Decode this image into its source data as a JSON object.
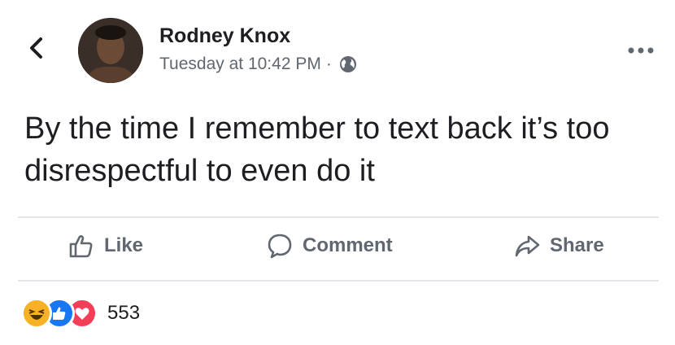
{
  "post": {
    "author": "Rodney Knox",
    "timestamp": "Tuesday at 10:42 PM",
    "separator": "·",
    "privacy_icon": "globe-icon",
    "text": "By the time I remember to text back it’s too disrespectful to even do it"
  },
  "actions": {
    "like_label": "Like",
    "comment_label": "Comment",
    "share_label": "Share"
  },
  "reactions": {
    "types": [
      "haha",
      "like",
      "love"
    ],
    "count": "553"
  },
  "colors": {
    "text": "#1c1e21",
    "secondary": "#606770",
    "like_blue": "#1877f2",
    "love_red": "#f33e58",
    "haha_yellow": "#f7b125"
  }
}
